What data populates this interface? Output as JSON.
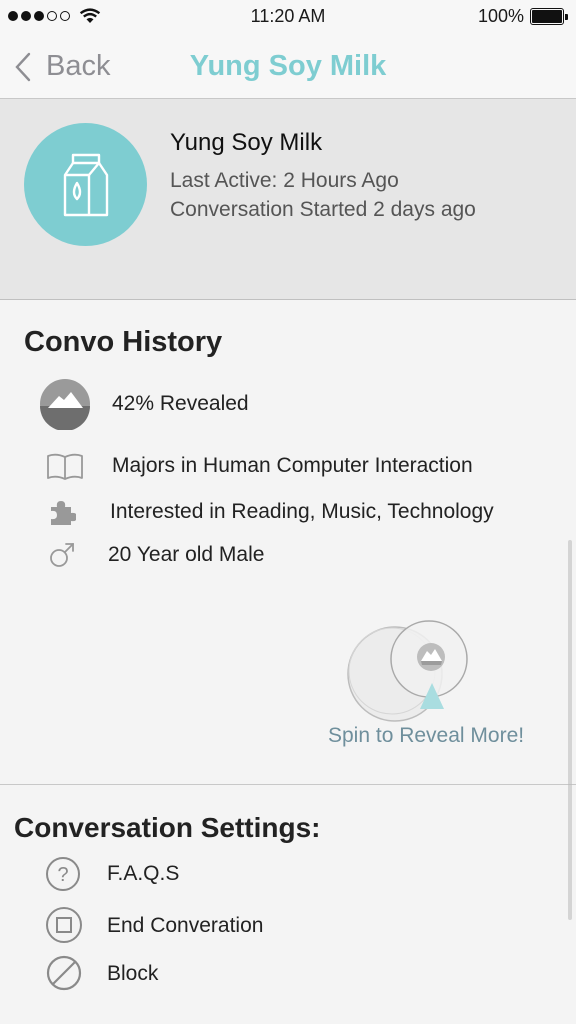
{
  "status_bar": {
    "time": "11:20 AM",
    "battery": "100%",
    "signal_bars": 5,
    "signal_filled": 3
  },
  "nav": {
    "back_label": "Back",
    "title": "Yung Soy Milk"
  },
  "profile": {
    "name": "Yung Soy Milk",
    "last_active": "Last Active: 2 Hours Ago",
    "started": "Conversation Started 2 days ago",
    "avatar_icon": "milk-carton-icon",
    "avatar_color": "#7ecdd1"
  },
  "history": {
    "title": "Convo History",
    "items": [
      {
        "icon": "mountain-reveal-icon",
        "label": "42% Revealed"
      },
      {
        "icon": "book-icon",
        "label": "Majors in Human Computer Interaction"
      },
      {
        "icon": "puzzle-icon",
        "label": "Interested in Reading, Music, Technology"
      },
      {
        "icon": "male-symbol-icon",
        "label": "20 Year old Male"
      }
    ],
    "revealed_percent": 42,
    "spin_label": "Spin to Reveal More!"
  },
  "settings": {
    "title": "Conversation Settings:",
    "items": [
      {
        "icon": "question-circle-icon",
        "label": "F.A.Q.S"
      },
      {
        "icon": "stop-square-icon",
        "label": "End Converation"
      },
      {
        "icon": "block-icon",
        "label": "Block"
      }
    ]
  },
  "colors": {
    "accent": "#7ecdd1",
    "link": "#6f8f9c",
    "muted": "#8e8e93"
  }
}
